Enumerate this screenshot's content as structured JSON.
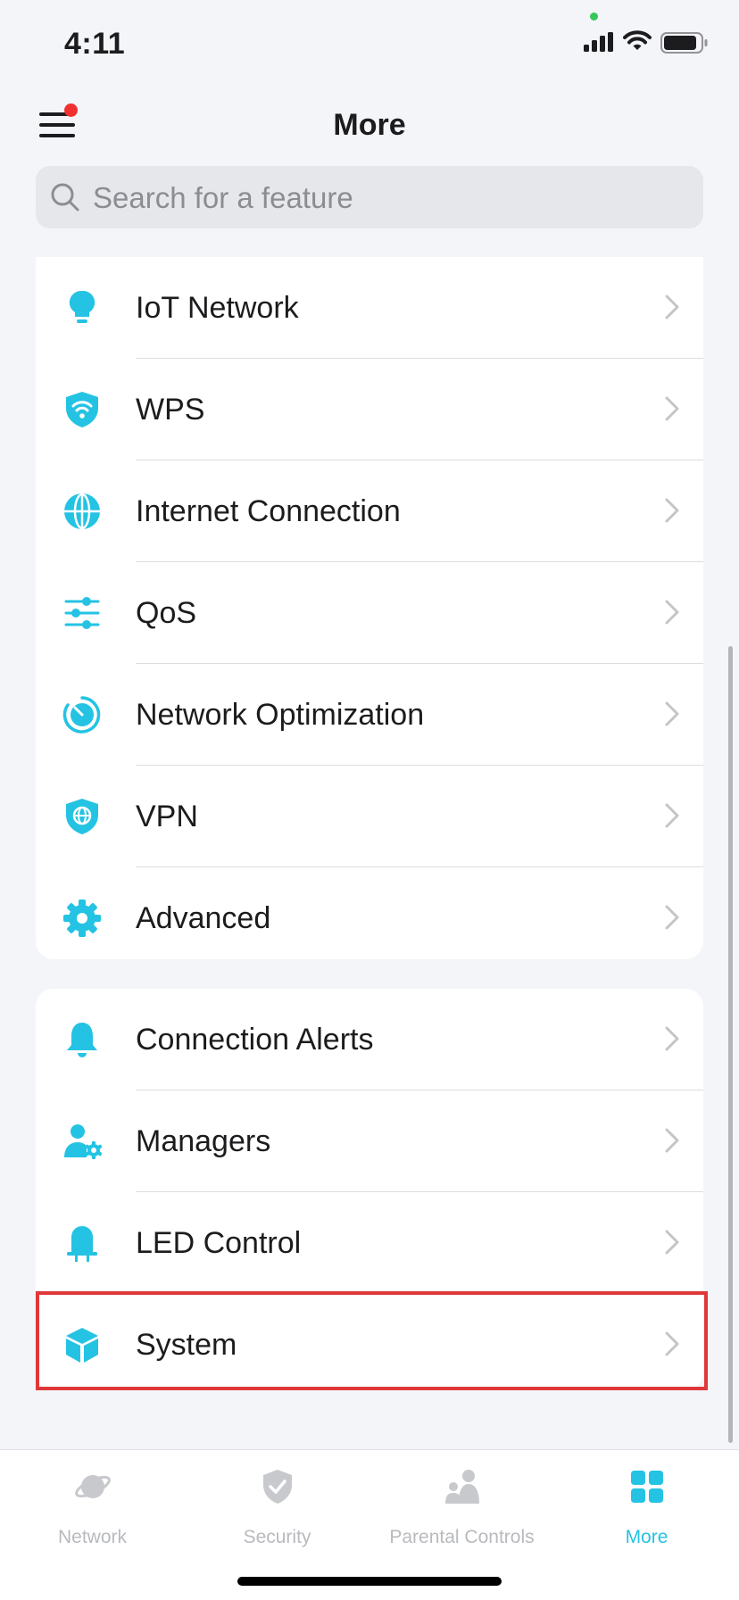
{
  "status_bar": {
    "time": "4:11"
  },
  "header": {
    "title": "More"
  },
  "search": {
    "placeholder": "Search for a feature",
    "value": ""
  },
  "groups": [
    {
      "items": [
        {
          "label": "IoT Network",
          "icon": "lightbulb-icon"
        },
        {
          "label": "WPS",
          "icon": "wifi-shield-icon"
        },
        {
          "label": "Internet Connection",
          "icon": "globe-icon"
        },
        {
          "label": "QoS",
          "icon": "sliders-icon"
        },
        {
          "label": "Network Optimization",
          "icon": "speedometer-icon"
        },
        {
          "label": "VPN",
          "icon": "vpn-shield-icon"
        },
        {
          "label": "Advanced",
          "icon": "gear-icon"
        }
      ]
    },
    {
      "items": [
        {
          "label": "Connection Alerts",
          "icon": "bell-icon"
        },
        {
          "label": "Managers",
          "icon": "user-gear-icon"
        },
        {
          "label": "LED Control",
          "icon": "led-icon"
        },
        {
          "label": "System",
          "icon": "cube-icon",
          "highlighted": true
        }
      ]
    }
  ],
  "tab_bar": {
    "tabs": [
      {
        "label": "Network",
        "icon": "planet-icon",
        "active": false
      },
      {
        "label": "Security",
        "icon": "shield-check-icon",
        "active": false
      },
      {
        "label": "Parental Controls",
        "icon": "family-icon",
        "active": false
      },
      {
        "label": "More",
        "icon": "grid-icon",
        "active": true
      }
    ]
  },
  "colors": {
    "accent": "#24c3e3",
    "highlight_border": "#e0383a",
    "notification_dot": "#f0302f"
  }
}
